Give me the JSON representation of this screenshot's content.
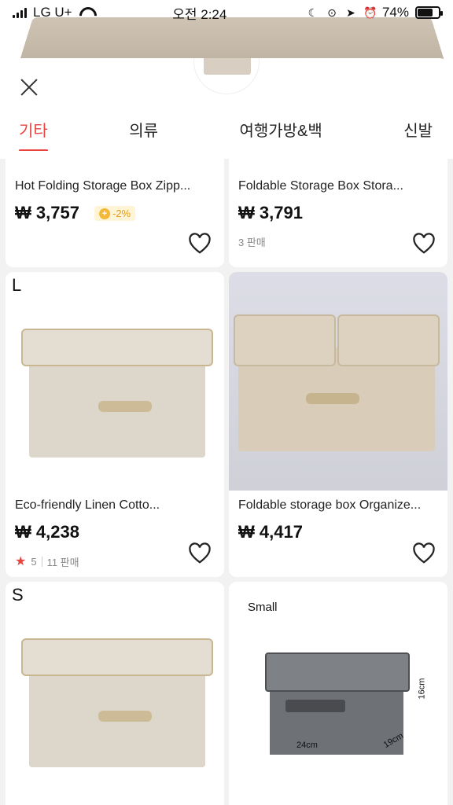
{
  "status_bar": {
    "carrier": "LG U+",
    "time": "오전 2:24",
    "battery": "74%",
    "battery_level": 0.74
  },
  "header": {
    "tabs": [
      {
        "label": "기타",
        "active": true
      },
      {
        "label": "의류",
        "active": false
      },
      {
        "label": "여행가방&백",
        "active": false
      },
      {
        "label": "신발",
        "active": false
      }
    ]
  },
  "products": [
    {
      "title": "Hot Folding Storage Box Zipp...",
      "price": "₩ 3,757",
      "discount": "-2%",
      "discount_icon": "coin-icon"
    },
    {
      "title": "Foldable Storage Box Stora...",
      "price": "₩ 3,791",
      "sold": "3 판매"
    },
    {
      "size_label": "L",
      "title": "Eco-friendly Linen Cotto...",
      "price": "₩ 4,238",
      "rating": "5",
      "sold": "11 판매"
    },
    {
      "title": "Foldable storage box Organize...",
      "price": "₩ 4,417"
    },
    {
      "size_label": "S"
    },
    {
      "size_label": "Small",
      "dims": {
        "width": "24cm",
        "depth": "19cm",
        "height": "16cm"
      }
    }
  ],
  "colors": {
    "accent": "#e8433f",
    "discount": "#e59a20"
  }
}
